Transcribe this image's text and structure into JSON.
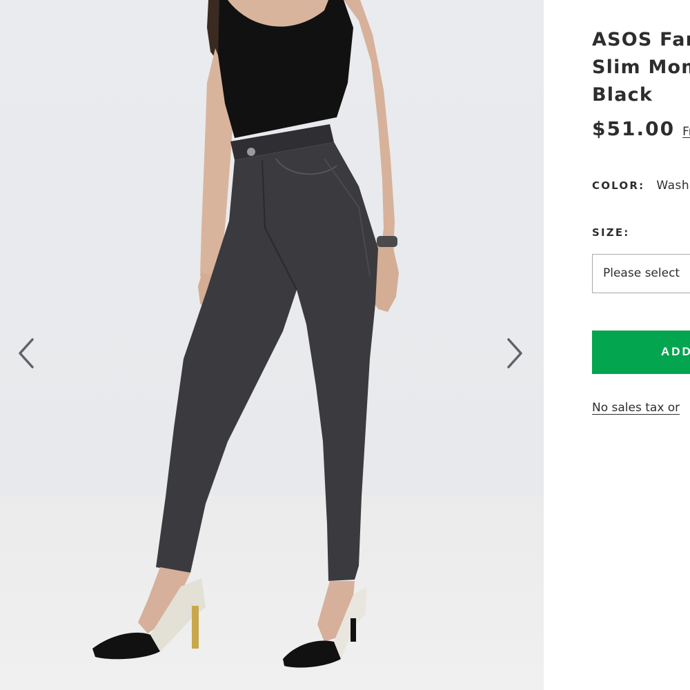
{
  "product": {
    "title_lines": [
      "ASOS Farl",
      "Slim Mom",
      "Black"
    ],
    "price": "$51.00",
    "price_note": "Fr",
    "color_label": "COLOR:",
    "color_value": "Wash",
    "size_label": "SIZE:",
    "size_placeholder": "Please select",
    "add_button_label": "ADD",
    "tax_note": "No sales tax or"
  },
  "gallery": {
    "prev_icon": "chevron-left-icon",
    "next_icon": "chevron-right-icon"
  },
  "colors": {
    "accent_button": "#03a54f",
    "text": "#2d2d2d",
    "select_border": "#a8a8a8",
    "background": "#e8eaed"
  }
}
